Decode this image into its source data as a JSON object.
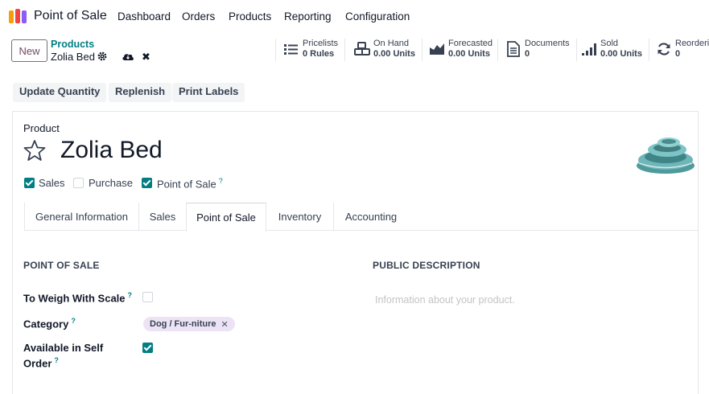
{
  "app": {
    "title": "Point of Sale"
  },
  "nav": {
    "items": [
      "Dashboard",
      "Orders",
      "Products",
      "Reporting",
      "Configuration"
    ]
  },
  "control": {
    "new_label": "New",
    "breadcrumb": "Products",
    "record_name": "Zolia Bed",
    "discard_symbol": "✖"
  },
  "smart_buttons": [
    {
      "label": "Pricelists",
      "value": "0 Rules",
      "icon": "list-icon"
    },
    {
      "label": "On Hand",
      "value": "0.00 Units",
      "icon": "cubes-icon"
    },
    {
      "label": "Forecasted",
      "value": "0.00 Units",
      "icon": "area-chart-icon"
    },
    {
      "label": "Documents",
      "value": "0",
      "icon": "document-icon"
    },
    {
      "label": "Sold",
      "value": "0.00 Units",
      "icon": "signal-icon"
    },
    {
      "label": "Reorderi",
      "value": "0",
      "icon": "refresh-icon"
    }
  ],
  "actions": {
    "update_quantity": "Update Quantity",
    "replenish": "Replenish",
    "print_labels": "Print Labels"
  },
  "product": {
    "label": "Product",
    "name": "Zolia Bed",
    "flags": {
      "sales": "Sales",
      "purchase": "Purchase",
      "point_of_sale": "Point of Sale",
      "help": "?"
    }
  },
  "tabs": [
    "General Information",
    "Sales",
    "Point of Sale",
    "Inventory",
    "Accounting"
  ],
  "pos_section": {
    "title": "POINT OF SALE",
    "to_weigh_label": "To Weigh With Scale",
    "category_label": "Category",
    "category_tag": "Dog / Fur-niture",
    "self_order_label_1": "Available in Self",
    "self_order_label_2": "Order",
    "help": "?"
  },
  "public_desc": {
    "title": "PUBLIC DESCRIPTION",
    "placeholder": "Information about your product."
  },
  "colors": {
    "brand": "#714B67",
    "accent": "#017e84",
    "tag_bg": "#ece4f5"
  }
}
